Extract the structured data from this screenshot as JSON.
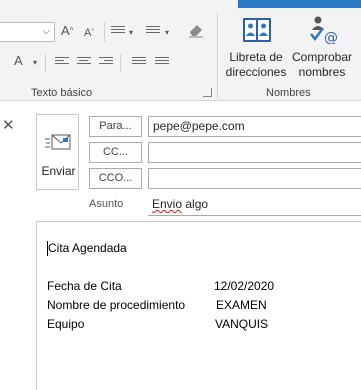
{
  "ribbon": {
    "font_dropdown_arrow": "⌵",
    "grow_font": "A",
    "shrink_font": "A",
    "font_color_letter": "A",
    "group_basic_text": "Texto básico",
    "group_names": "Nombres",
    "address_book_label_1": "Libreta de",
    "address_book_label_2": "direcciones",
    "check_names_label_1": "Comprobar",
    "check_names_label_2": "nombres"
  },
  "compose": {
    "send_label": "Enviar",
    "to_button": "Para...",
    "cc_button": "CC...",
    "bcc_button": "CCO...",
    "to_value": "pepe@pepe.com",
    "cc_value": "",
    "bcc_value": "",
    "subject_label": "Asunto",
    "subject_word1": "Envio",
    "subject_word2": " algo"
  },
  "body": {
    "heading": "Cita Agendada",
    "rows": [
      {
        "label": "Fecha de Cita",
        "value": "12/02/2020"
      },
      {
        "label": "Nombre de procedimiento",
        "value": "EXAMEN"
      },
      {
        "label": "Equipo",
        "value": "VANQUIS"
      }
    ]
  },
  "colors": {
    "ribbon_bg": "#f3f3f3",
    "accent_blue": "#2b78c5"
  }
}
